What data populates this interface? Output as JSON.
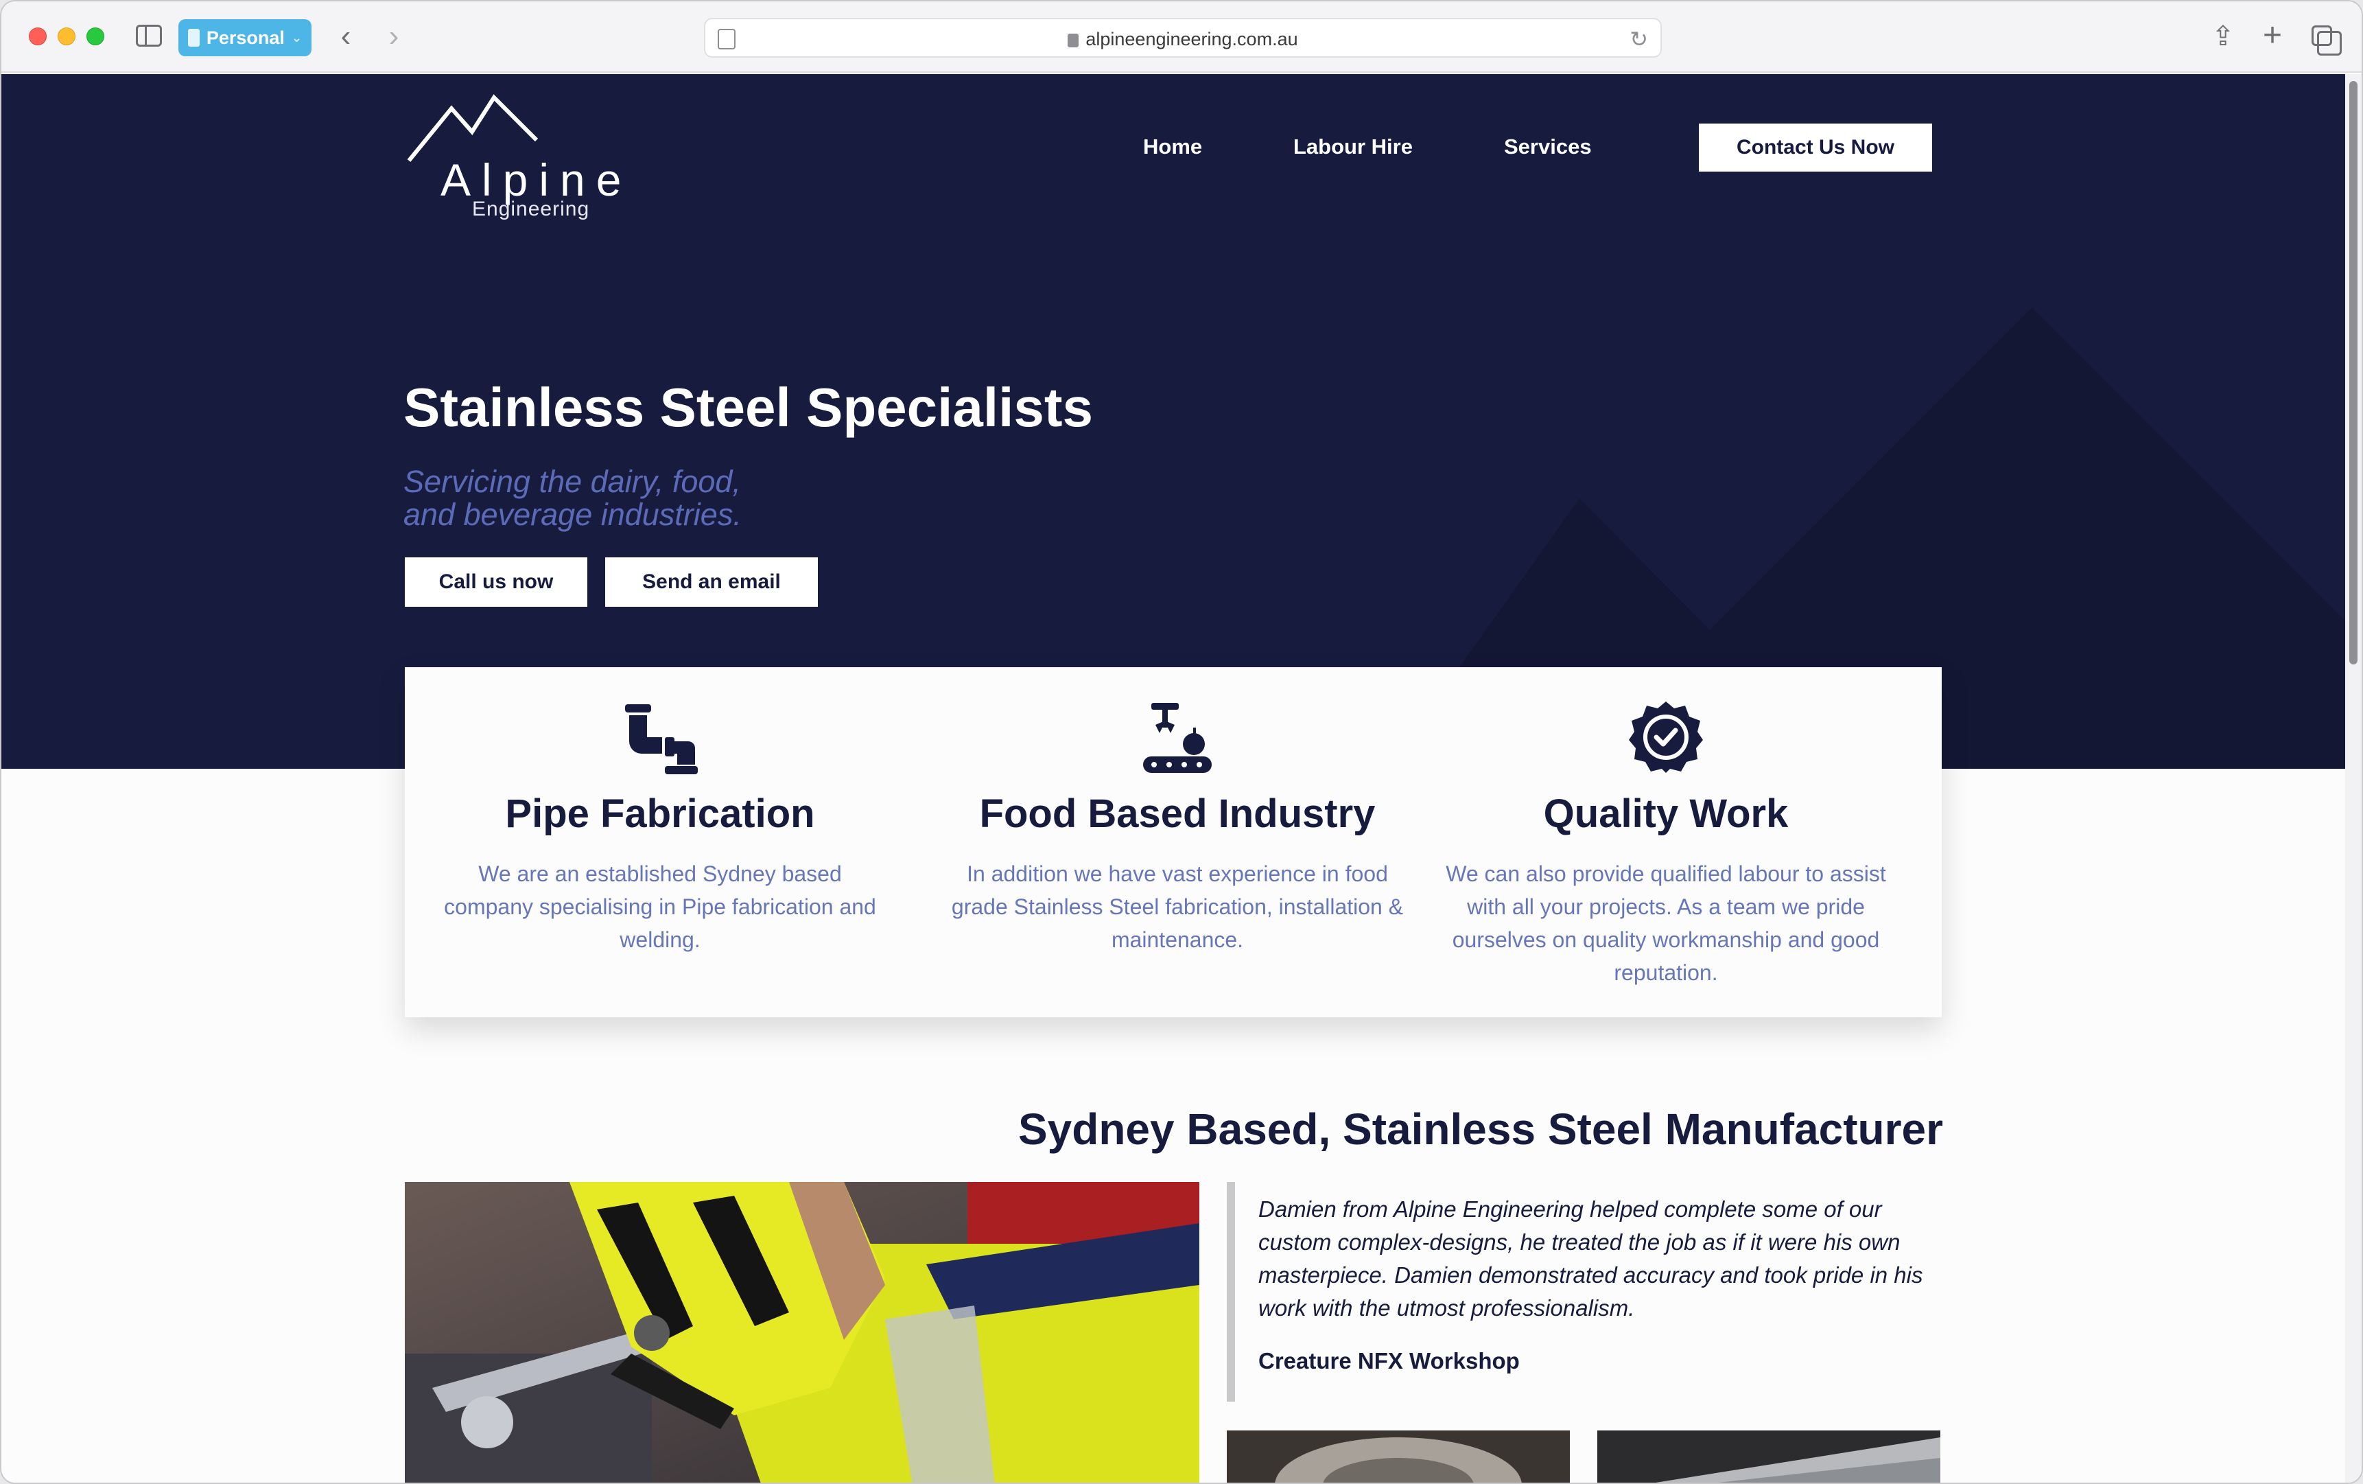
{
  "browser": {
    "profile_label": "Personal",
    "url": "alpineengineering.com.au"
  },
  "logo": {
    "wordmark": "Alpine",
    "subtitle": "Engineering"
  },
  "nav": {
    "items": [
      "Home",
      "Labour Hire",
      "Services"
    ],
    "cta": "Contact Us Now"
  },
  "hero": {
    "title": "Stainless Steel Specialists",
    "subtitle_line1": "Servicing the dairy, food,",
    "subtitle_line2": "and beverage industries.",
    "call_button": "Call us now",
    "email_button": "Send an email"
  },
  "features": [
    {
      "icon": "pipe-icon",
      "title": "Pipe Fabrication",
      "text": "We are an established Sydney based company specialising in Pipe fabrication and welding."
    },
    {
      "icon": "food-conveyor-icon",
      "title": "Food Based Industry",
      "text": "In addition we have vast experience in food grade Stainless Steel fabrication, installation & maintenance."
    },
    {
      "icon": "quality-badge-icon",
      "title": "Quality Work",
      "text": "We can also provide qualified labour to assist with all your projects. As a team we pride ourselves on quality workmanship and good reputation."
    }
  ],
  "about": {
    "title": "Sydney Based, Stainless Steel Manufacturer",
    "quote": "Damien from Alpine Engineering helped complete some of our custom complex-designs, he treated the job as if it were his own masterpiece. Damien demonstrated accuracy and took pride in his work with the utmost professionalism.",
    "quote_author": "Creature NFX Workshop"
  },
  "colors": {
    "navy": "#171c3f",
    "accent_text": "#6776b8",
    "hero_subtitle": "#5c6bb8"
  }
}
